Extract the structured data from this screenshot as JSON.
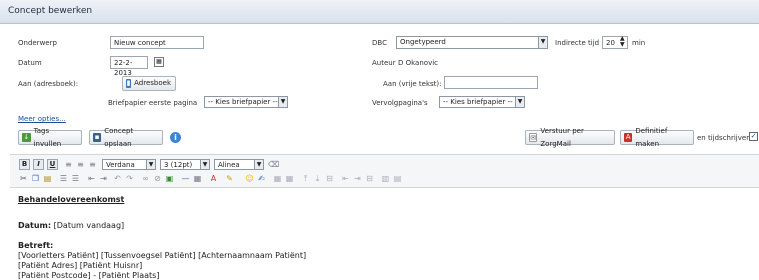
{
  "window": {
    "title": "Concept bewerken"
  },
  "form": {
    "onderwerp_label": "Onderwerp",
    "onderwerp_value": "Nieuw concept",
    "datum_label": "Datum",
    "datum_value": "22-2-2013",
    "aan_adresboek_label": "Aan (adresboek):",
    "adresboek_button": "Adresboek",
    "briefpapier_label": "Briefpapier eerste pagina",
    "briefpapier_value": "-- Kies briefpapier --",
    "meer_opties": "Meer opties...",
    "dbc_label": "DBC",
    "dbc_value": "Ongetypeerd",
    "indirecte_tijd_label": "Indirecte tijd",
    "indirecte_tijd_value": "20",
    "min_label": "min",
    "auteur_label": "Auteur",
    "auteur_value": "D Okanovic",
    "aan_vrij_label": "Aan (vrije tekst):",
    "aan_vrij_value": "",
    "vervolg_label": "Vervolgpagina's",
    "vervolg_value": "-- Kies briefpapier --"
  },
  "actions": {
    "tags_invullen": "Tags invullen",
    "concept_opslaan": "Concept opslaan",
    "verstuur_zorgmail": "Verstuur per ZorgMail",
    "definitief_maken": "Definitief maken",
    "tijdschrijven_label": "en tijdschrijven",
    "tijdschrijven_checked": true
  },
  "editor_toolbar": {
    "bold": "B",
    "italic": "I",
    "underline": "U",
    "font": "Verdana",
    "size": "3 (12pt)",
    "paragraph": "Alinea"
  },
  "document": {
    "heading": "Behandelovereenkomst",
    "datum_label": "Datum:",
    "datum_value": "[Datum vandaag]",
    "betreft_label": "Betreft:",
    "line1": "[Voorletters Patiënt] [Tussenvoegsel Patiënt] [Achternaamnaam Patiënt]",
    "line2": "[Patiënt Adres] [Patiënt Huisnr]",
    "line3": "[Patiënt Postcode] - [Patiënt Plaats]"
  },
  "colors": {
    "titlebar": "#dfe6ef",
    "link": "#1a4e9a",
    "info_icon": "#3a86d6"
  }
}
